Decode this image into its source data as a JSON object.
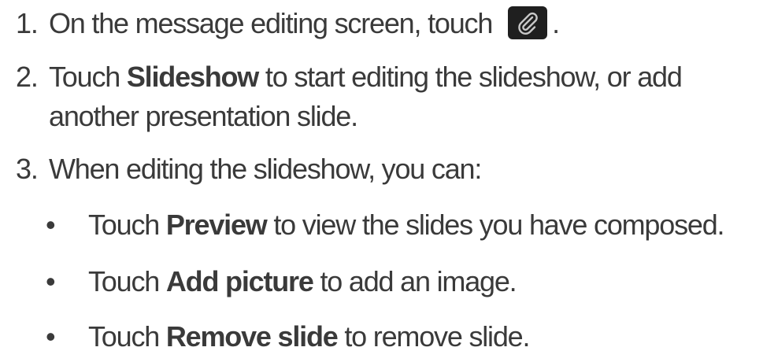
{
  "steps": [
    {
      "number": "1.",
      "text": "On the message editing screen, touch",
      "icon": "paperclip-attach-icon",
      "after_icon": "."
    },
    {
      "number": "2.",
      "pre": "Touch ",
      "bold": "Slideshow",
      "post": " to start editing the slideshow, or add",
      "continuation": "another presentation slide."
    },
    {
      "number": "3.",
      "text": "When editing the slideshow, you can:"
    }
  ],
  "bullets": [
    {
      "marker": "•",
      "pre": "Touch ",
      "bold": "Preview",
      "post": " to view the slides you have composed."
    },
    {
      "marker": "•",
      "pre": "Touch ",
      "bold": "Add picture",
      "post": " to add an image."
    },
    {
      "marker": "•",
      "pre": "Touch ",
      "bold": "Remove slide",
      "post": " to remove slide."
    }
  ],
  "colors": {
    "text": "#3a3a3a",
    "icon_background": "#1f1f1f",
    "icon_stroke": "#c8c8c8"
  }
}
